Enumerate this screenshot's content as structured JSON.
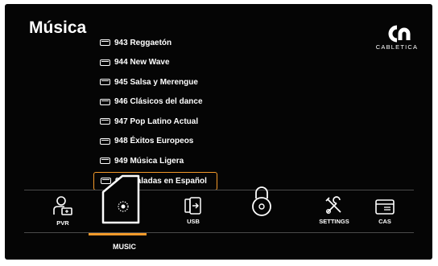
{
  "page": {
    "title": "Música"
  },
  "brand": {
    "name": "CABLETICA",
    "logo_icon": "cabletica-logo-icon"
  },
  "channels": [
    {
      "label": "943 Reggaetón",
      "selected": false
    },
    {
      "label": "944  New Wave",
      "selected": false
    },
    {
      "label": "945 Salsa y Merengue",
      "selected": false
    },
    {
      "label": "946 Clásicos del dance",
      "selected": false
    },
    {
      "label": "947 Pop Latino Actual",
      "selected": false
    },
    {
      "label": "948 Éxitos Europeos",
      "selected": false
    },
    {
      "label": "949 Música Ligera",
      "selected": false
    },
    {
      "label": "950 Baladas en Español",
      "selected": true
    }
  ],
  "menu": {
    "items": [
      {
        "id": "pvr",
        "label": "PVR",
        "icon": "pvr-user-icon"
      },
      {
        "id": "music",
        "label": "MUSIC",
        "icon": "music-note-icon",
        "selected": true
      },
      {
        "id": "usb",
        "label": "USB",
        "icon": "usb-icon"
      },
      {
        "id": "lock",
        "label": "",
        "icon": "lock-icon"
      },
      {
        "id": "settings",
        "label": "SETTINGS",
        "icon": "settings-tools-icon"
      },
      {
        "id": "cas",
        "label": "CAS",
        "icon": "cas-card-icon"
      }
    ]
  },
  "colors": {
    "background": "#050505",
    "accent": "#f39a2a",
    "text": "#ffffff"
  }
}
